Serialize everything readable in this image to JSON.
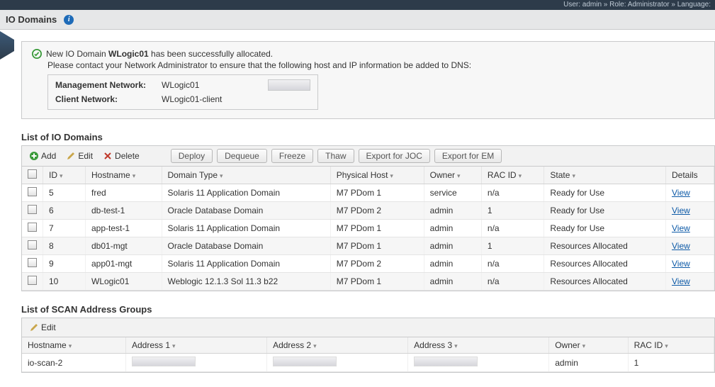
{
  "topbar": "User: admin » Role: Administrator » Language:",
  "page_title": "IO Domains",
  "alert": {
    "line1_pre": "New IO Domain ",
    "line1_strong": "WLogic01",
    "line1_post": " has been successfully allocated.",
    "line2": "Please contact your Network Administrator to ensure that the following host and IP information be added to DNS:",
    "mgmt_label": "Management Network:",
    "mgmt_value": "WLogic01",
    "client_label": "Client Network:",
    "client_value": "WLogic01-client"
  },
  "domains": {
    "title": "List of IO Domains",
    "toolbar": {
      "add": "Add",
      "edit": "Edit",
      "delete": "Delete",
      "deploy": "Deploy",
      "dequeue": "Dequeue",
      "freeze": "Freeze",
      "thaw": "Thaw",
      "export_joc": "Export for JOC",
      "export_em": "Export for EM"
    },
    "cols": {
      "id": "ID",
      "hostname": "Hostname",
      "domain_type": "Domain Type",
      "physical_host": "Physical Host",
      "owner": "Owner",
      "rac_id": "RAC ID",
      "state": "State",
      "details": "Details"
    },
    "view_label": "View",
    "rows": [
      {
        "id": "5",
        "hostname": "fred",
        "domain_type": "Solaris 11 Application Domain",
        "physical_host": "M7 PDom 1",
        "owner": "service",
        "rac_id": "n/a",
        "state": "Ready for Use"
      },
      {
        "id": "6",
        "hostname": "db-test-1",
        "domain_type": "Oracle Database Domain",
        "physical_host": "M7 PDom 2",
        "owner": "admin",
        "rac_id": "1",
        "state": "Ready for Use"
      },
      {
        "id": "7",
        "hostname": "app-test-1",
        "domain_type": "Solaris 11 Application Domain",
        "physical_host": "M7 PDom 1",
        "owner": "admin",
        "rac_id": "n/a",
        "state": "Ready for Use"
      },
      {
        "id": "8",
        "hostname": "db01-mgt",
        "domain_type": "Oracle Database Domain",
        "physical_host": "M7 PDom 1",
        "owner": "admin",
        "rac_id": "1",
        "state": "Resources Allocated"
      },
      {
        "id": "9",
        "hostname": "app01-mgt",
        "domain_type": "Solaris 11 Application Domain",
        "physical_host": "M7 PDom 2",
        "owner": "admin",
        "rac_id": "n/a",
        "state": "Resources Allocated"
      },
      {
        "id": "10",
        "hostname": "WLogic01",
        "domain_type": "Weblogic 12.1.3 Sol 11.3 b22",
        "physical_host": "M7 PDom 1",
        "owner": "admin",
        "rac_id": "n/a",
        "state": "Resources Allocated"
      }
    ]
  },
  "scan": {
    "title": "List of SCAN Address Groups",
    "toolbar": {
      "edit": "Edit"
    },
    "cols": {
      "hostname": "Hostname",
      "addr1": "Address 1",
      "addr2": "Address 2",
      "addr3": "Address 3",
      "owner": "Owner",
      "rac_id": "RAC ID"
    },
    "rows": [
      {
        "hostname": "io-scan-2",
        "owner": "admin",
        "rac_id": "1"
      }
    ]
  }
}
